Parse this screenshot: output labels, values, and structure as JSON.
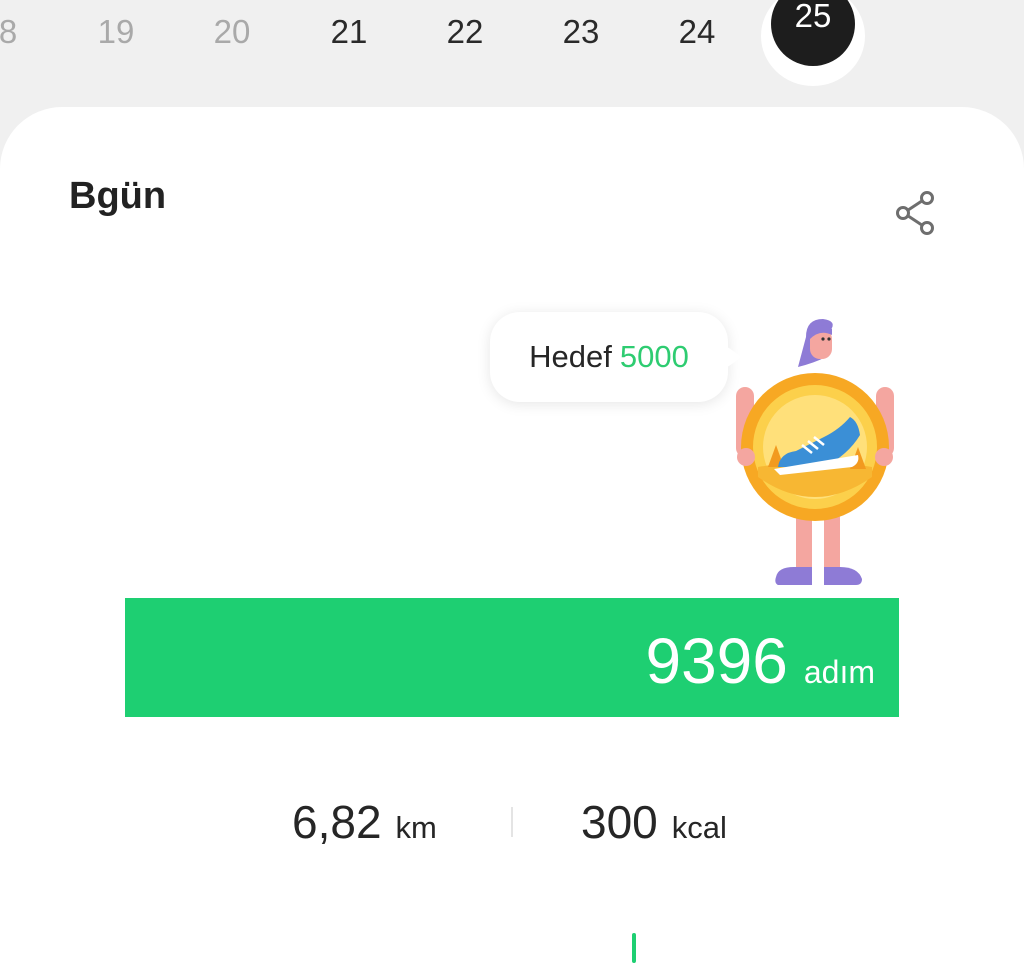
{
  "date_strip": {
    "days": [
      {
        "label": "8",
        "state": "past"
      },
      {
        "label": "19",
        "state": "past"
      },
      {
        "label": "20",
        "state": "past"
      },
      {
        "label": "21",
        "state": "normal"
      },
      {
        "label": "22",
        "state": "normal"
      },
      {
        "label": "23",
        "state": "normal"
      },
      {
        "label": "24",
        "state": "normal"
      },
      {
        "label": "25",
        "state": "selected"
      }
    ]
  },
  "card": {
    "title": "Bgün",
    "share_icon": "share-icon",
    "goal": {
      "label": "Hedef",
      "value": "5000"
    },
    "illustration_icon": "goal-badge-illustration",
    "steps": {
      "count": "9396",
      "unit": "adım"
    },
    "stats": {
      "distance": {
        "value": "6,82",
        "unit": "km"
      },
      "calories": {
        "value": "300",
        "unit": "kcal"
      }
    }
  },
  "colors": {
    "accent_green": "#1ecf72",
    "goal_green": "#2ecc71",
    "selected_day_bg": "#1d1d1d",
    "past_day_text": "#a9a9a9",
    "badge_orange": "#f7a823",
    "shoe_blue": "#3b8fd6"
  }
}
